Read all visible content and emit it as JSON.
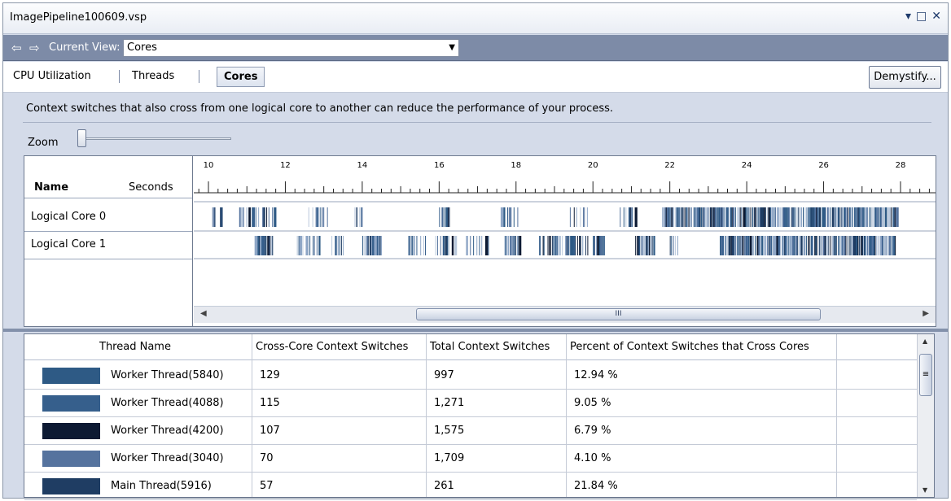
{
  "window": {
    "title": "ImagePipeline100609.vsp",
    "ctrl_min": "▾",
    "ctrl_max": "□",
    "ctrl_close": "✕"
  },
  "toolbar": {
    "back_icon": "⇦",
    "forward_icon": "⇨",
    "current_view_label": "Current View:",
    "current_view_value": "Cores"
  },
  "tabs": {
    "cpu": "CPU Utilization",
    "threads": "Threads",
    "cores": "Cores",
    "selected": "Cores",
    "demystify": "Demystify..."
  },
  "info_text": "Context switches that also cross from one logical core to another can reduce the performance of your process.",
  "zoom_label": "Zoom",
  "timeline": {
    "name_header": "Name",
    "seconds_header": "Seconds",
    "ticks": [
      "10",
      "12",
      "14",
      "16",
      "18",
      "20",
      "22",
      "24",
      "26",
      "28"
    ],
    "tick_range": [
      10,
      28
    ],
    "rows": [
      "Logical Core 0",
      "Logical Core 1"
    ],
    "scroll_thumb": "III"
  },
  "grid": {
    "headers": [
      "Thread Name",
      "Cross-Core Context Switches",
      "Total Context Switches",
      "Percent of Context Switches that Cross Cores"
    ],
    "rows": [
      {
        "color": "#2e5a85",
        "name": "Worker Thread(5840)",
        "cross": "129",
        "total": "997",
        "pct": "12.94 %"
      },
      {
        "color": "#365f8c",
        "name": "Worker Thread(4088)",
        "cross": "115",
        "total": "1,271",
        "pct": "9.05 %"
      },
      {
        "color": "#0d1a33",
        "name": "Worker Thread(4200)",
        "cross": "107",
        "total": "1,575",
        "pct": "6.79 %"
      },
      {
        "color": "#55739e",
        "name": "Worker Thread(3040)",
        "cross": "70",
        "total": "1,709",
        "pct": "4.10 %"
      },
      {
        "color": "#1f3d63",
        "name": "Main Thread(5916)",
        "cross": "57",
        "total": "261",
        "pct": "21.84 %"
      }
    ]
  }
}
